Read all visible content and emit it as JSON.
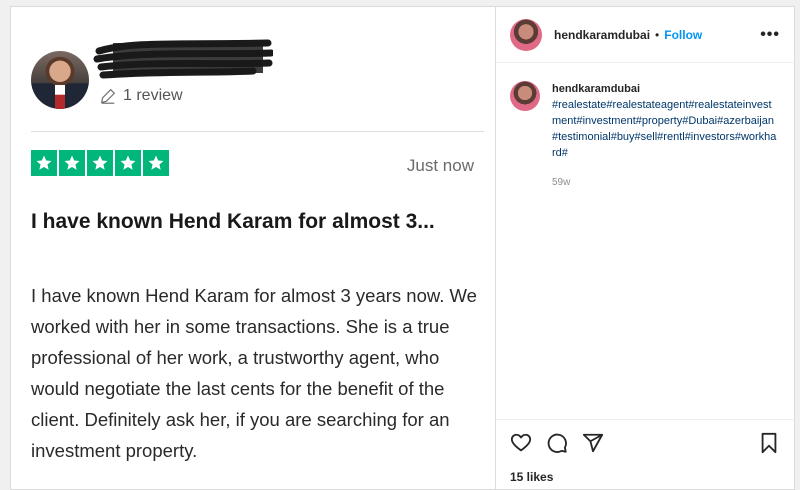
{
  "review": {
    "review_count": "1 review",
    "rating_stars": 5,
    "time": "Just now",
    "title": "I have known Hend Karam for almost 3...",
    "body": "I have known Hend Karam for almost 3 years now. We worked with her in some transactions. She is a true professional of her work, a trustworthy agent, who would negotiate the last cents for the benefit of the client. Definitely ask her, if you are searching for an investment property.",
    "star_color": "#00b67a"
  },
  "post": {
    "username": "hendkaramdubai",
    "separator": "•",
    "follow_label": "Follow",
    "more_label": "•••",
    "caption_username": "hendkaramdubai",
    "hashtags": "#realestate#realestateagent#realestateinvestment#investment#property#Dubai#azerbaijan#testimonial#buy#sell#rentl#investors#workhard#",
    "age": "59w",
    "likes": "15 likes",
    "follow_color": "#0095f6"
  }
}
